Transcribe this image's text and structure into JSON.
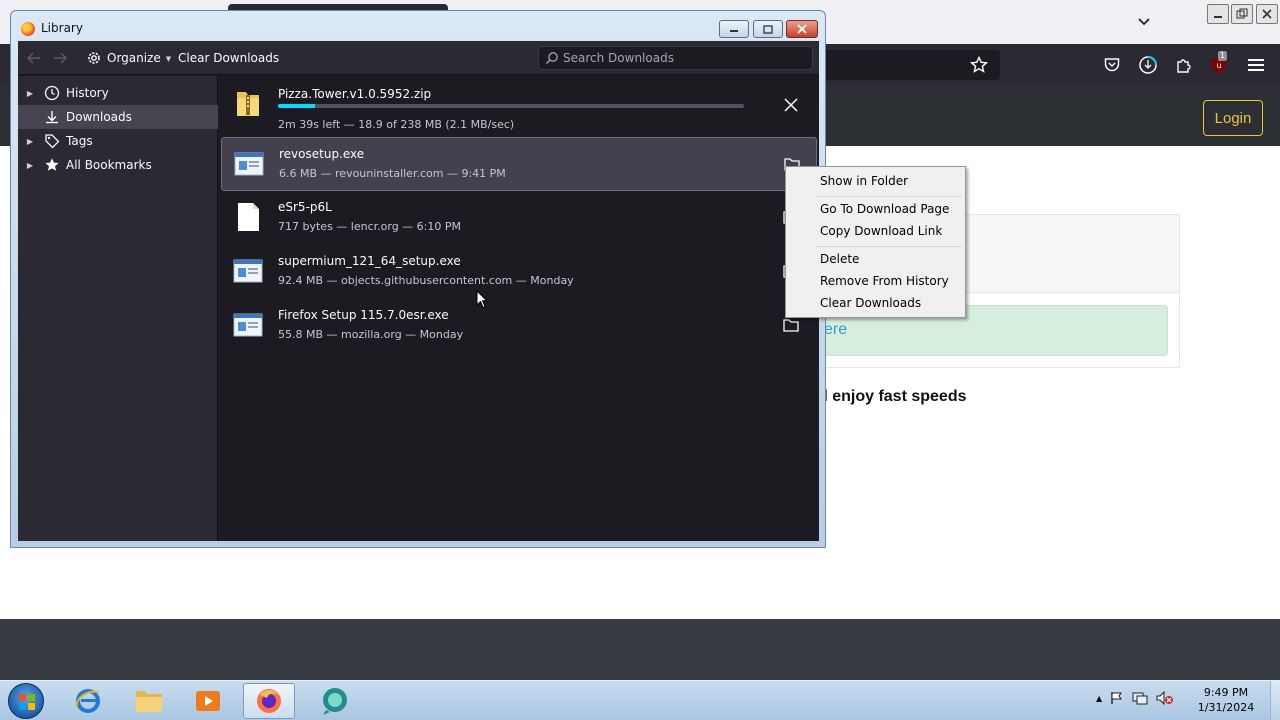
{
  "library": {
    "title": "Library",
    "organize_label": "Organize",
    "clear_downloads_label": "Clear Downloads",
    "search_placeholder": "Search Downloads"
  },
  "sidebar": {
    "items": [
      {
        "label": "History",
        "icon": "clock-icon",
        "expandable": true
      },
      {
        "label": "Downloads",
        "icon": "download-icon",
        "expandable": false,
        "selected": true
      },
      {
        "label": "Tags",
        "icon": "tag-icon",
        "expandable": true
      },
      {
        "label": "All Bookmarks",
        "icon": "star-icon",
        "expandable": true
      }
    ]
  },
  "downloads": [
    {
      "name": "Pizza.Tower.v1.0.5952.zip",
      "status": "2m 39s left — 18.9 of 238 MB (2.1 MB/sec)",
      "progress": 0.079,
      "action": "cancel"
    },
    {
      "name": "revosetup.exe",
      "status": "6.6 MB — revouninstaller.com — 9:41 PM",
      "action": "show-in-folder"
    },
    {
      "name": "eSr5-p6L",
      "status": "717 bytes — lencr.org — 6:10 PM",
      "action": "show-in-folder"
    },
    {
      "name": "supermium_121_64_setup.exe",
      "status": "92.4 MB — objects.githubusercontent.com — Monday",
      "action": "show-in-folder"
    },
    {
      "name": "Firefox Setup 115.7.0esr.exe",
      "status": "55.8 MB — mozilla.org — Monday",
      "action": "show-in-folder"
    }
  ],
  "context_menu": {
    "items": [
      "Show in Folder",
      "Go To Download Page",
      "Copy Download Link",
      "Delete",
      "Remove From History",
      "Clear Downloads"
    ]
  },
  "browser": {
    "login_label": "Login",
    "page_link_fragment": "ere",
    "page_text_fragment": "d enjoy fast speeds",
    "extension_badge": "1"
  },
  "taskbar": {
    "time": "9:49 PM",
    "date": "1/31/2024"
  },
  "colors": {
    "accent": "#00ddff",
    "dark_bg": "#1c1b22",
    "toolbar_bg": "#2b2a33",
    "login_border": "#f0c23a"
  }
}
